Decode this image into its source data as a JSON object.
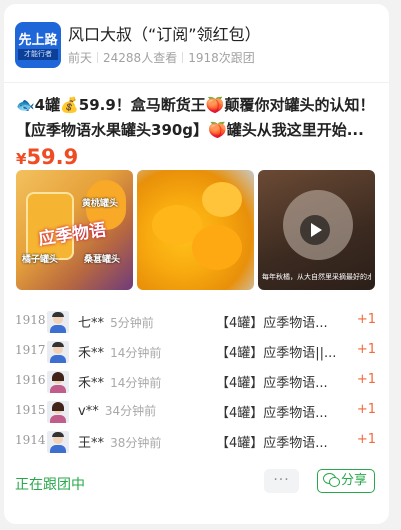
{
  "header": {
    "avatar_text_main": "先上路",
    "avatar_text_sub": "才能行者",
    "title": "风口大叔（“订阅”领红包）",
    "posted": "前天",
    "views": "24288人查看",
    "follows": "1918次跟团"
  },
  "post": {
    "line1": "🐟4罐💰59.9！盒马断货王🍑颠覆你对罐头的认知！",
    "line2": "【应季物语水果罐头390g】🍑罐头从我这里开始...",
    "currency": "¥",
    "price": "59.9"
  },
  "thumbs": {
    "t1_big": "应季物语",
    "t1_label1": "黄桃罐头",
    "t1_label2": "橘子罐头",
    "t1_label3": "桑葚罐头",
    "t3_caption": "每年秋橘，从大自然里采摘最好的水果"
  },
  "orders": [
    {
      "num": "1918",
      "name": "七**",
      "time": "5分钟前",
      "product": "【4罐】应季物语...",
      "qty": "+1",
      "avatar": "male"
    },
    {
      "num": "1917",
      "name": "禾**",
      "time": "14分钟前",
      "product": "【4罐】应季物语||...",
      "qty": "+1",
      "avatar": "male"
    },
    {
      "num": "1916",
      "name": "禾**",
      "time": "14分钟前",
      "product": "【4罐】应季物语...",
      "qty": "+1",
      "avatar": "female"
    },
    {
      "num": "1915",
      "name": "v**",
      "time": "34分钟前",
      "product": "【4罐】应季物语...",
      "qty": "+1",
      "avatar": "female"
    },
    {
      "num": "1914",
      "name": "王**",
      "time": "38分钟前",
      "product": "【4罐】应季物语...",
      "qty": "+1",
      "avatar": "male"
    }
  ],
  "footer": {
    "status": "正在跟团中",
    "more": "···",
    "share": "分享"
  },
  "colors": {
    "accent_green": "#27a84a",
    "price_red": "#f04c23",
    "qty_orange": "#f06a3c"
  }
}
